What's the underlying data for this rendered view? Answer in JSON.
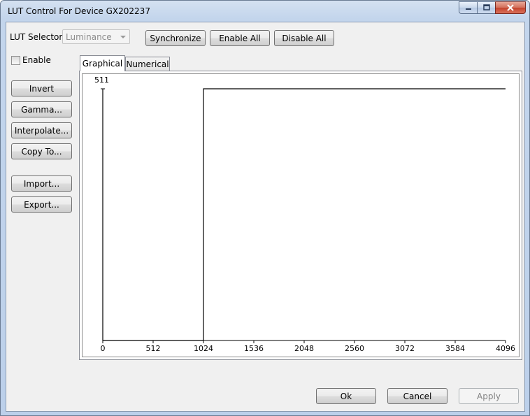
{
  "window": {
    "title": "LUT Control For Device GX202237",
    "caption_buttons": [
      "minimize-icon",
      "maximize-icon",
      "close-icon"
    ]
  },
  "toolbar": {
    "lut_selector_label": "LUT Selector:",
    "lut_selector_value": "Luminance",
    "synchronize_label": "Synchronize",
    "enable_all_label": "Enable All",
    "disable_all_label": "Disable All"
  },
  "sidebar": {
    "enable_label": "Enable",
    "enable_checked": false,
    "invert_label": "Invert",
    "gamma_label": "Gamma...",
    "interpolate_label": "Interpolate...",
    "copy_to_label": "Copy To...",
    "import_label": "Import...",
    "export_label": "Export..."
  },
  "tabs": {
    "graphical": "Graphical",
    "numerical": "Numerical",
    "active": "graphical"
  },
  "chart_data": {
    "type": "line",
    "x_ticks": [
      "0",
      "512",
      "1024",
      "1536",
      "2048",
      "2560",
      "3072",
      "3584",
      "4096"
    ],
    "y_max_label": "511",
    "xlim": [
      0,
      4096
    ],
    "ylim": [
      0,
      511
    ],
    "series": [
      {
        "x": [
          0,
          0,
          1024,
          1024,
          4096
        ],
        "y": [
          511,
          0,
          0,
          511,
          511
        ]
      }
    ]
  },
  "footer": {
    "ok_label": "Ok",
    "cancel_label": "Cancel",
    "apply_label": "Apply"
  }
}
